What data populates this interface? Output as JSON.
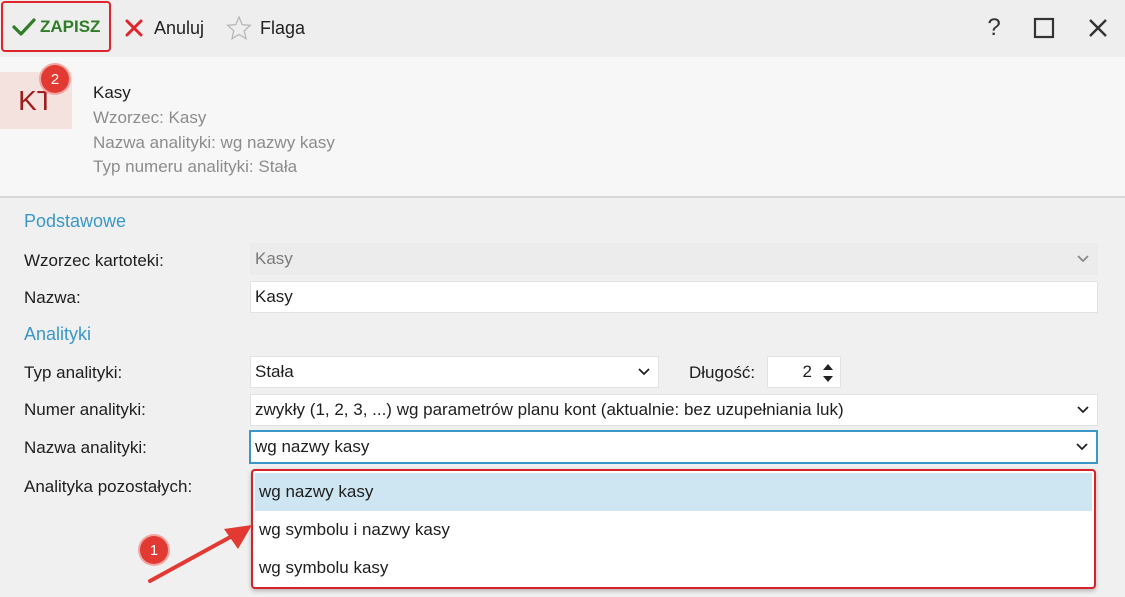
{
  "toolbar": {
    "save_label": "ZAPISZ",
    "cancel_label": "Anuluj",
    "flag_label": "Flaga",
    "help_label": "?"
  },
  "header": {
    "avatar_text": "KT",
    "title": "Kasy",
    "lines": [
      "Wzorzec: Kasy",
      "Nazwa analityki: wg nazwy kasy",
      "Typ numeru analityki: Stała"
    ]
  },
  "form": {
    "section_basic": "Podstawowe",
    "wzorzec_label": "Wzorzec kartoteki:",
    "wzorzec_value": "Kasy",
    "nazwa_label": "Nazwa:",
    "nazwa_value": "Kasy",
    "section_analytics": "Analityki",
    "typ_label": "Typ analityki:",
    "typ_value": "Stała",
    "dlugosc_label": "Długość:",
    "dlugosc_value": "2",
    "numer_label": "Numer analityki:",
    "numer_value": "zwykły (1, 2, 3, ...) wg parametrów planu kont (aktualnie: bez uzupełniania luk)",
    "nazwa_analityki_label": "Nazwa analityki:",
    "nazwa_analityki_value": "wg nazwy kasy",
    "pozostalych_label": "Analityka pozostałych:"
  },
  "dropdown": {
    "options": [
      "wg nazwy kasy",
      "wg symbolu i nazwy kasy",
      "wg symbolu kasy"
    ],
    "selected": "wg nazwy kasy"
  },
  "annotations": {
    "badge_1": "1",
    "badge_2": "2"
  },
  "colors": {
    "accent": "#3a97c7",
    "highlight": "#e0242c",
    "save_green": "#2f7d27",
    "selected_bg": "#cde6f2"
  }
}
